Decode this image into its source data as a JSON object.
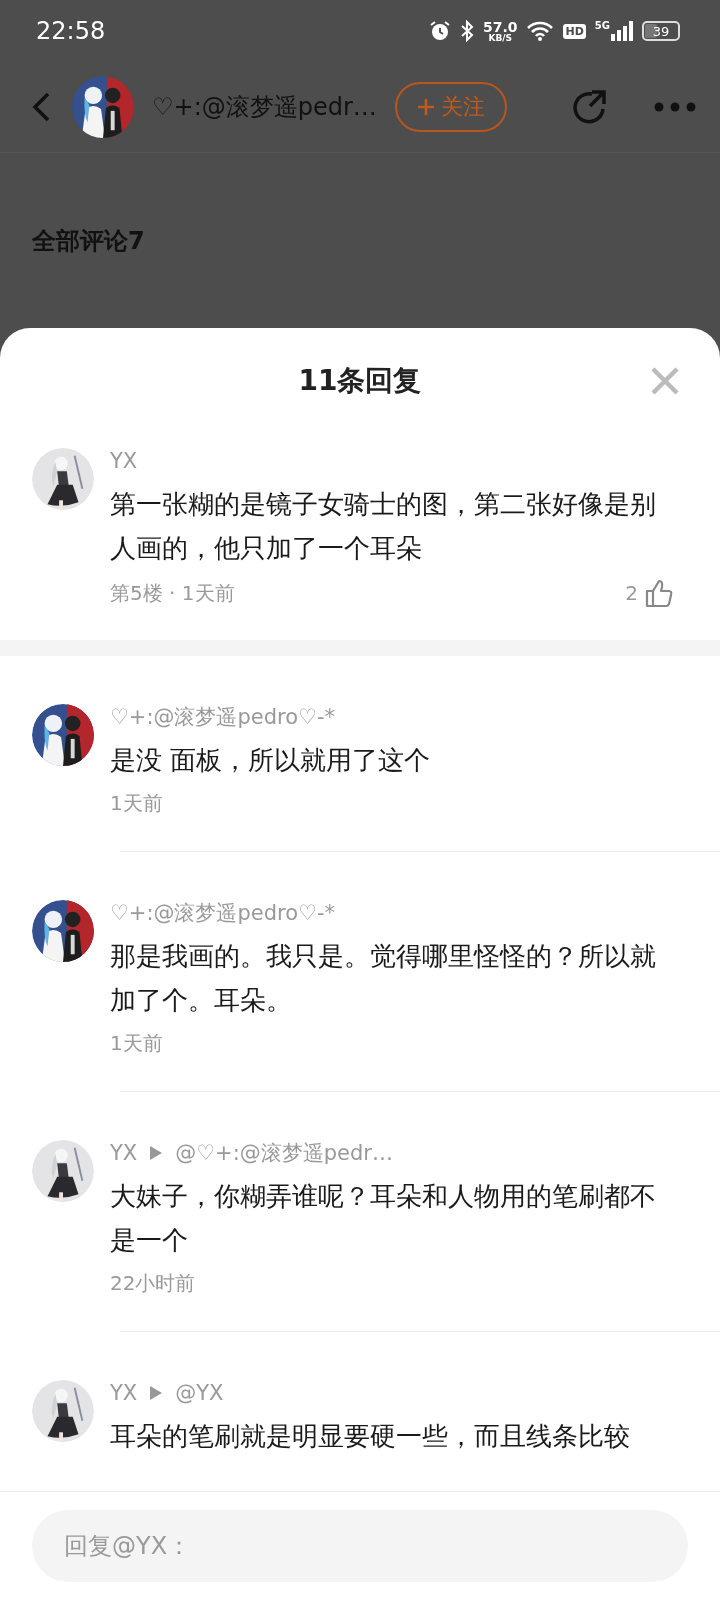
{
  "status_bar": {
    "time": "22:58",
    "net_speed": "57.0",
    "net_unit": "KB/S",
    "hd": "HD",
    "network": "5G",
    "battery": "39"
  },
  "header": {
    "author": "♡+:@滚梦遥pedr…",
    "follow": "关注",
    "avatar": {
      "kind": "pair"
    }
  },
  "section_title": "全部评论7",
  "sheet": {
    "title": "11条回复"
  },
  "main_reply": {
    "author": "YX",
    "kind": "single",
    "text": "第一张糊的是镜子女骑士的图，第二张好像是别人画的，他只加了一个耳朵",
    "meta": "第5楼 · 1天前",
    "likes": "2"
  },
  "replies": [
    {
      "author": "♡+:@滚梦遥pedro♡-*",
      "kind": "pair",
      "text": "是没 面板，所以就用了这个",
      "time": "1天前"
    },
    {
      "author": "♡+:@滚梦遥pedro♡-*",
      "kind": "pair",
      "text": "那是我画的。我只是。觉得哪里怪怪的？所以就加了个。耳朵。",
      "time": "1天前"
    },
    {
      "author": "YX",
      "kind": "single",
      "reply_to": "@♡+:@滚梦遥pedr…",
      "text": "大妹子，你糊弄谁呢？耳朵和人物用的笔刷都不是一个",
      "time": "22小时前"
    },
    {
      "author": "YX",
      "kind": "single",
      "reply_to": "@YX",
      "text": "耳朵的笔刷就是明显要硬一些，而且线条比较"
    }
  ],
  "reply_box": {
    "placeholder": "回复@YX："
  }
}
